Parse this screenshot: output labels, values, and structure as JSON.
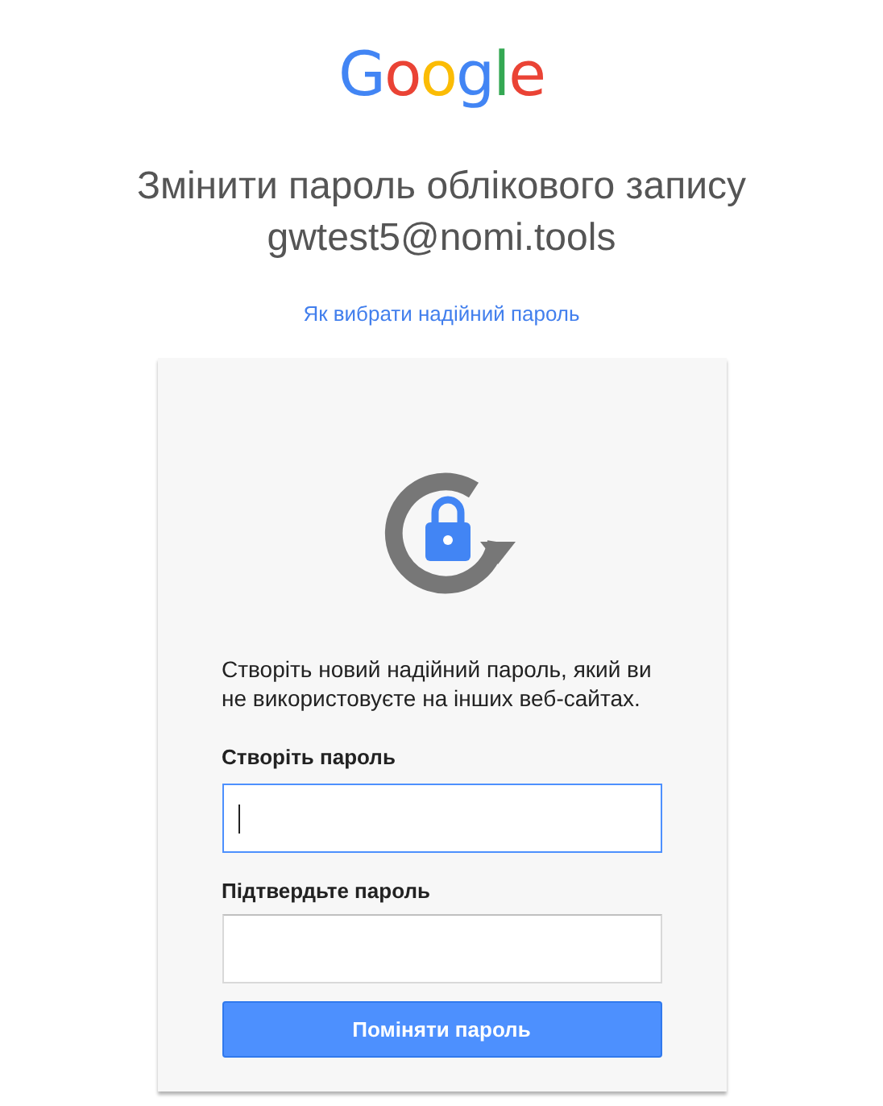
{
  "logo": "Google",
  "title_lines": [
    "Змінити пароль облікового запису",
    "gwtest5@nomi.tools"
  ],
  "help_link": "Як вибрати надійний пароль",
  "card": {
    "instruction": "Створіть новий надійний пароль, який ви не використовуєте на інших веб-сайтах.",
    "fields": [
      {
        "label": "Створіть пароль",
        "focused": true
      },
      {
        "label": "Підтвердьте пароль",
        "focused": false
      }
    ],
    "submit": "Поміняти пароль"
  }
}
